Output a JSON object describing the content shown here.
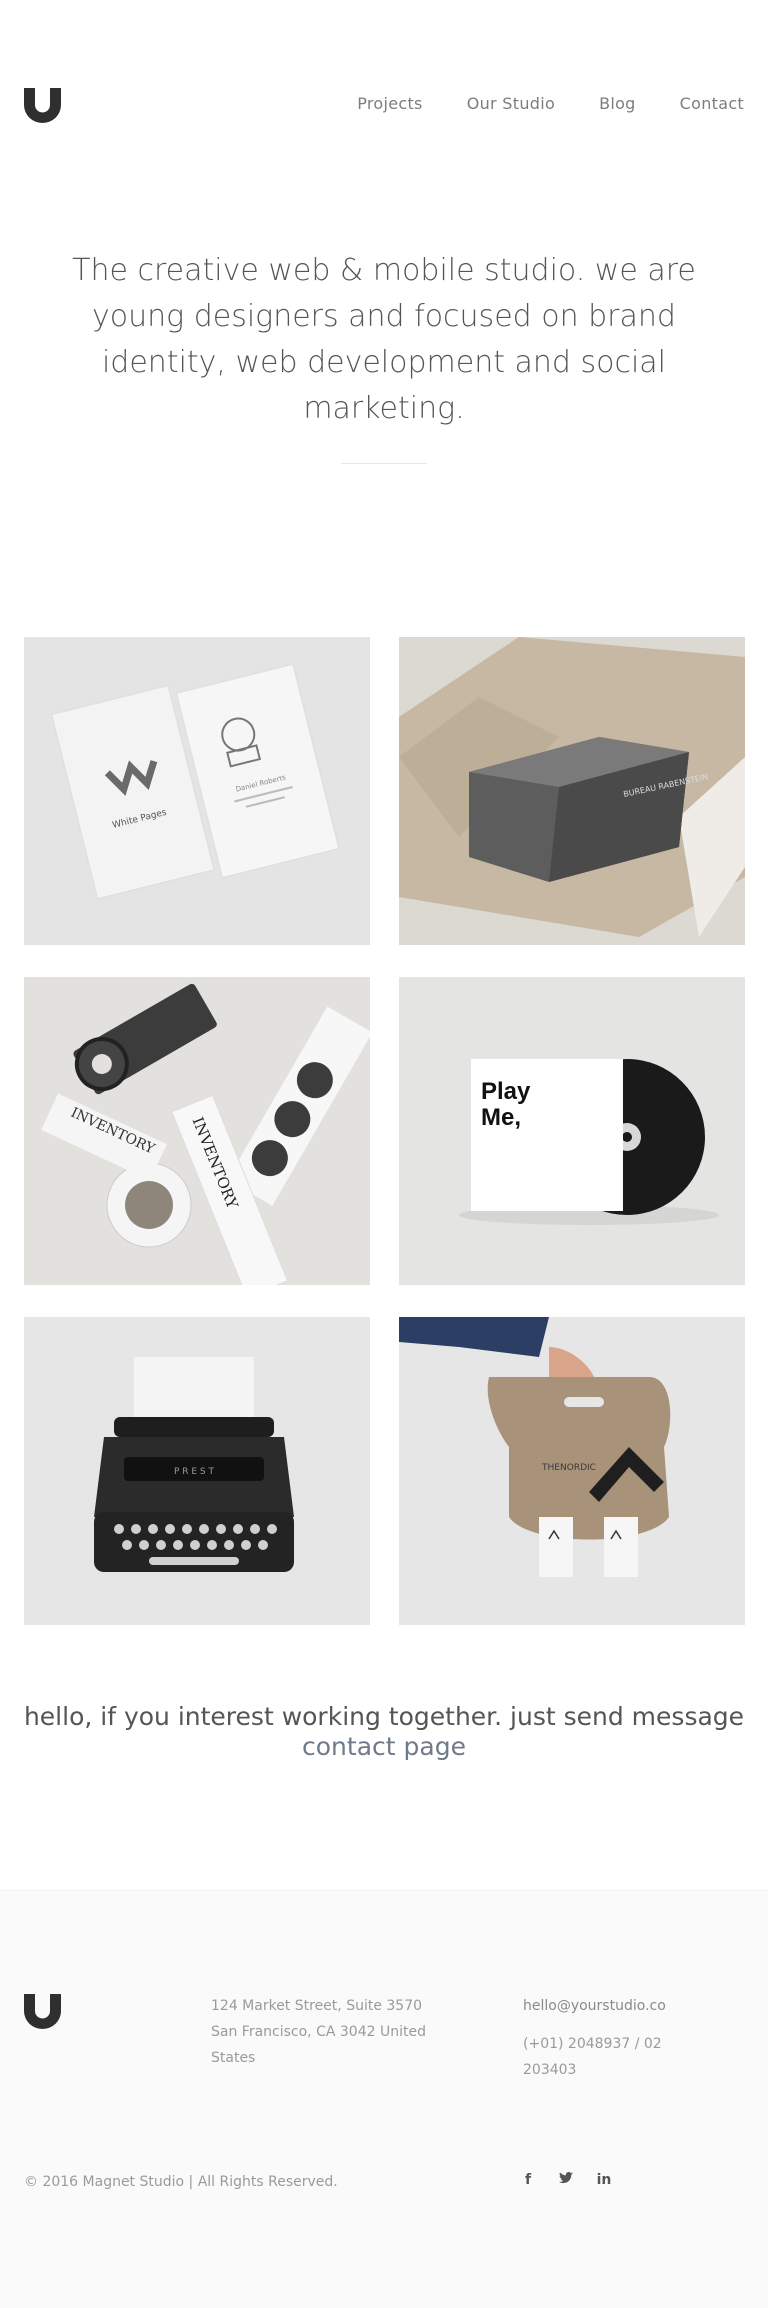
{
  "brand": {
    "logo_icon": "magnet-icon",
    "color": "#2f2f2f"
  },
  "nav": {
    "items": [
      "Projects",
      "Our Studio",
      "Blog",
      "Contact"
    ]
  },
  "hero": {
    "text": "The creative web & mobile studio. we are young designers and focused on brand identity, web development and social marketing."
  },
  "portfolio": {
    "tiles": [
      {
        "card_brand": "White Pages",
        "card_text": "Daniel Roberts"
      },
      {
        "box_text": "BUREAU RABENSTEIN"
      },
      {
        "roll_text": "INVENTORY"
      },
      {
        "cd_title_1": "Play",
        "cd_title_2": "Me,"
      },
      {
        "typewriter_text": "P R E S T"
      },
      {
        "bag_text": "THENORDIC"
      }
    ]
  },
  "cta": {
    "text": "hello, if you interest working together. just send message",
    "link": "contact page"
  },
  "footer": {
    "address": "124 Market Street, Suite 3570 San Francisco, CA 3042 United States",
    "email": "hello@yourstudio.co",
    "phone": "(+01) 2048937 / 02 203403",
    "copyright": "© 2016 Magnet Studio | All Rights Reserved.",
    "social": [
      {
        "icon": "facebook-icon",
        "glyph": "f"
      },
      {
        "icon": "twitter-icon",
        "glyph": "t"
      },
      {
        "icon": "linkedin-icon",
        "glyph": "in"
      }
    ]
  }
}
